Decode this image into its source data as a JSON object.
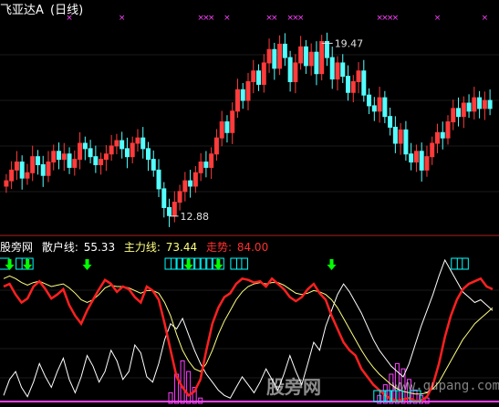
{
  "stock": {
    "name": "飞亚达A",
    "period": "(日线)"
  },
  "price_chart": {
    "high_label": "19.47",
    "low_label": "12.88",
    "y_range": [
      12.5,
      20.2
    ]
  },
  "indicator": {
    "name": "股旁网",
    "retail_label": "散户线:",
    "retail_value": "55.33",
    "main_label": "主力线:",
    "main_value": "73.44",
    "trend_label": "走势:",
    "trend_value": "84.00"
  },
  "watermark": {
    "text": "股旁网",
    "url": "www.gupang.com"
  },
  "colors": {
    "up": "#ff3b3b",
    "down": "#54ffff",
    "red_line": "#ff2020",
    "yellow_line": "#ffff80",
    "white_line": "#ffffff",
    "magenta": "#ff40ff",
    "arrow": "#00ff00",
    "box": "#00ffff",
    "divider": "#b02020"
  },
  "chart_data": {
    "type": "line",
    "title": "",
    "price_closes": [
      14.2,
      14.6,
      14.9,
      14.3,
      14.5,
      15.1,
      14.8,
      14.4,
      14.9,
      15.3,
      15.0,
      15.2,
      14.7,
      15.0,
      15.6,
      15.4,
      15.1,
      14.8,
      15.0,
      15.2,
      15.5,
      15.7,
      15.4,
      15.1,
      15.6,
      15.8,
      15.4,
      15.0,
      14.6,
      13.9,
      13.2,
      12.9,
      13.4,
      13.8,
      14.2,
      14.0,
      14.5,
      14.9,
      14.7,
      15.2,
      15.8,
      16.4,
      16.0,
      16.8,
      17.6,
      17.2,
      17.9,
      18.3,
      17.8,
      18.6,
      19.1,
      18.4,
      19.3,
      18.8,
      17.9,
      18.6,
      19.2,
      18.5,
      19.0,
      18.2,
      19.4,
      18.8,
      18.0,
      18.6,
      18.1,
      17.5,
      17.9,
      18.3,
      17.4,
      17.0,
      16.8,
      17.3,
      16.6,
      16.2,
      15.6,
      16.1,
      15.2,
      14.9,
      15.3,
      14.6,
      15.1,
      15.6,
      16.0,
      15.8,
      16.4,
      16.9,
      16.6,
      17.1,
      16.8,
      17.3,
      16.9,
      17.2,
      16.9
    ],
    "high": 19.47,
    "low": 12.88,
    "signal_days": [
      12,
      22,
      37,
      38,
      39,
      42,
      50,
      51,
      54,
      55,
      56,
      71,
      72,
      73,
      74,
      82,
      91
    ],
    "indicator": {
      "ylim": [
        0,
        110
      ],
      "retail_line": [
        88,
        90,
        82,
        76,
        79,
        88,
        92,
        86,
        79,
        82,
        86,
        74,
        66,
        60,
        70,
        78,
        86,
        93,
        90,
        84,
        88,
        86,
        80,
        76,
        88,
        85,
        78,
        60,
        40,
        20,
        12,
        6,
        9,
        18,
        40,
        60,
        72,
        80,
        83,
        90,
        94,
        93,
        91,
        92,
        88,
        94,
        90,
        86,
        80,
        77,
        80,
        86,
        90,
        83,
        78,
        66,
        56,
        46,
        40,
        36,
        26,
        20,
        14,
        10,
        6,
        3,
        2,
        3,
        4,
        2,
        2,
        5,
        14,
        30,
        50,
        66,
        78,
        86,
        90,
        92,
        94,
        88,
        86
      ],
      "main_line": [
        94,
        96,
        94,
        91,
        89,
        91,
        92,
        90,
        88,
        89,
        90,
        87,
        83,
        78,
        76,
        78,
        82,
        87,
        89,
        88,
        88,
        87,
        85,
        83,
        85,
        85,
        83,
        76,
        66,
        52,
        40,
        32,
        26,
        24,
        30,
        40,
        52,
        62,
        70,
        78,
        84,
        88,
        90,
        91,
        90,
        91,
        91,
        89,
        86,
        83,
        82,
        83,
        85,
        84,
        82,
        78,
        72,
        64,
        56,
        48,
        40,
        33,
        27,
        22,
        18,
        14,
        11,
        9,
        8,
        7,
        7,
        8,
        11,
        16,
        24,
        32,
        40,
        48,
        54,
        60,
        64,
        68,
        72
      ],
      "white_line": [
        6,
        18,
        24,
        12,
        5,
        16,
        30,
        20,
        12,
        24,
        34,
        18,
        8,
        20,
        36,
        28,
        16,
        24,
        40,
        32,
        18,
        24,
        44,
        38,
        20,
        16,
        30,
        48,
        60,
        56,
        64,
        52,
        40,
        30,
        22,
        16,
        10,
        6,
        4,
        12,
        20,
        14,
        8,
        16,
        26,
        18,
        10,
        22,
        36,
        24,
        14,
        30,
        46,
        40,
        58,
        70,
        82,
        90,
        84,
        76,
        68,
        58,
        48,
        40,
        34,
        28,
        24,
        20,
        30,
        44,
        58,
        70,
        82,
        96,
        108,
        100,
        92,
        84,
        80,
        76,
        78,
        74,
        70
      ],
      "magenta_bars": [
        0,
        0,
        0,
        0,
        0,
        0,
        0,
        0,
        0,
        0,
        0,
        0,
        0,
        0,
        0,
        0,
        0,
        0,
        0,
        0,
        0,
        0,
        0,
        0,
        0,
        0,
        0,
        0,
        8,
        22,
        32,
        24,
        12,
        4,
        0,
        0,
        0,
        0,
        0,
        0,
        0,
        0,
        0,
        0,
        0,
        0,
        0,
        0,
        0,
        0,
        0,
        0,
        0,
        0,
        0,
        0,
        0,
        0,
        0,
        0,
        0,
        0,
        0,
        6,
        14,
        22,
        30,
        26,
        18,
        10,
        6,
        4,
        0,
        0,
        0,
        0,
        0,
        0,
        0,
        0,
        0,
        0,
        0
      ],
      "arrow_days": [
        1,
        4,
        14,
        31,
        36,
        55
      ],
      "box_days": [
        0,
        3,
        4,
        28,
        29,
        30,
        31,
        32,
        33,
        34,
        35,
        36,
        39,
        40,
        76,
        77
      ],
      "bottom_boxes": [
        63,
        64,
        65,
        66,
        69
      ]
    }
  }
}
